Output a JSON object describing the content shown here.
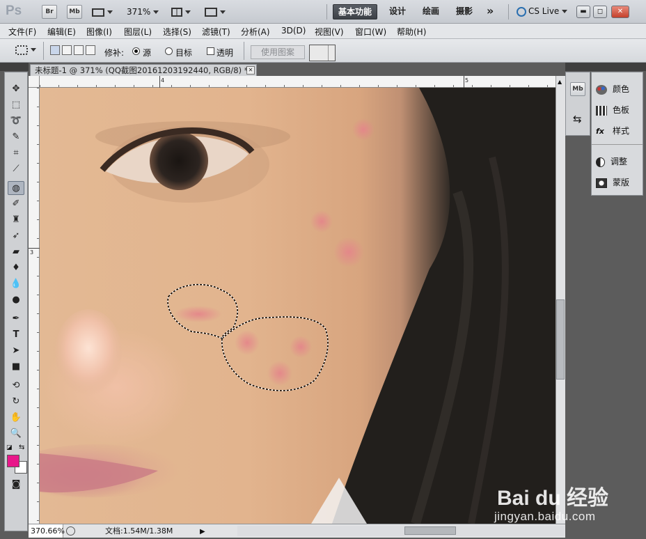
{
  "app": {
    "logo": "Ps",
    "bridge_label": "Br",
    "minibridge_label": "Mb",
    "zoom_level": "371%"
  },
  "workspaces": [
    {
      "label": "基本功能",
      "active": true
    },
    {
      "label": "设计",
      "active": false
    },
    {
      "label": "绘画",
      "active": false
    },
    {
      "label": "摄影",
      "active": false
    }
  ],
  "more_workspaces": "»",
  "cs_live": "CS Live",
  "menu": [
    "文件(F)",
    "编辑(E)",
    "图像(I)",
    "图层(L)",
    "选择(S)",
    "滤镜(T)",
    "分析(A)",
    "3D(D)",
    "视图(V)",
    "窗口(W)",
    "帮助(H)"
  ],
  "options": {
    "patch_label": "修补:",
    "source_label": "源",
    "destination_label": "目标",
    "transparent_label": "透明",
    "use_pattern_label": "使用图案",
    "source_selected": true
  },
  "document": {
    "tab_title": "未标题-1 @ 371% (QQ截图20161203192440, RGB/8) *",
    "close": "✕"
  },
  "rulers": {
    "top_labels": [
      "4",
      "5"
    ],
    "left_labels": [
      "3"
    ]
  },
  "right_panels": {
    "items": [
      "颜色",
      "色板",
      "样式",
      "调整",
      "蒙版"
    ],
    "mini_labels": [
      "Mb"
    ]
  },
  "status": {
    "zoom": "370.66%",
    "doc_info": "文档:1.54M/1.38M"
  },
  "colors": {
    "foreground": "#e8178a",
    "background": "#ffffff",
    "accent": "#3d4147"
  },
  "watermark": {
    "main": "Bai du 经验",
    "sub": "jingyan.baidu.com"
  }
}
